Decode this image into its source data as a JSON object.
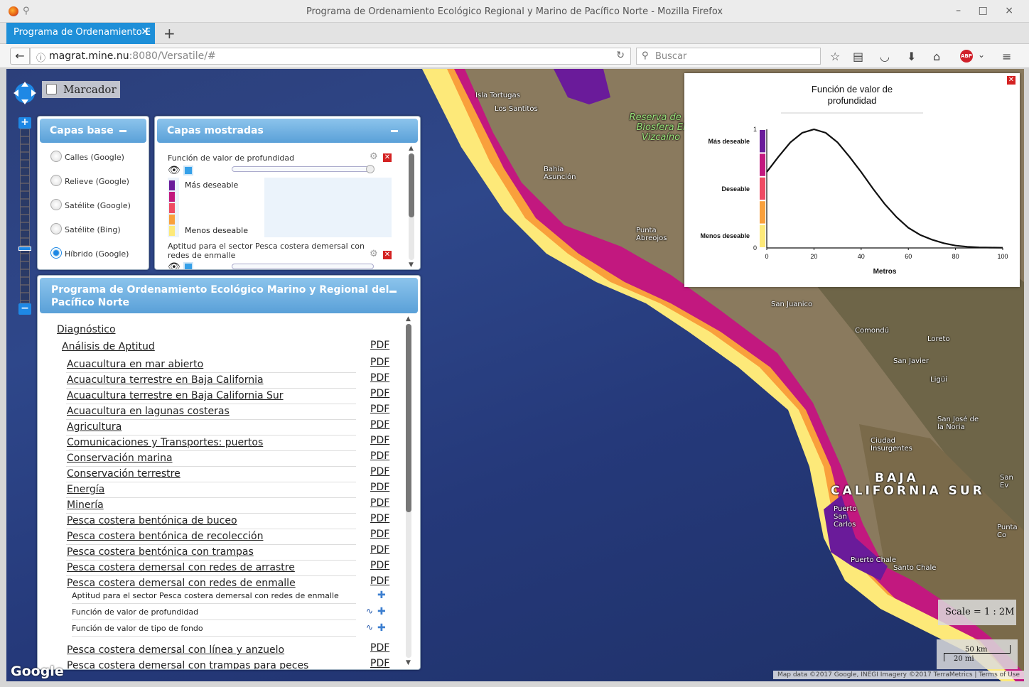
{
  "window": {
    "title": "Programa de Ordenamiento Ecológico Regional y Marino de Pacífico Norte - Mozilla Firefox",
    "controls": "– □ ×"
  },
  "tabs": [
    {
      "label": "Programa de Ordenamiento E",
      "active": true
    }
  ],
  "navbar": {
    "url_host": "magrat.mine.nu",
    "url_rest": ":8080/Versatile/#",
    "search_placeholder": "Buscar"
  },
  "map": {
    "marcador_label": "Marcador",
    "places": [
      {
        "id": "isla-tortugas",
        "name": "Isla Tortugas"
      },
      {
        "id": "los-santitos",
        "name": "Los Santitos"
      },
      {
        "id": "reserva",
        "name": "Reserva de la Biosfera El Vizcaíno"
      },
      {
        "id": "bahia-asuncion",
        "name": "Bahía Asunción"
      },
      {
        "id": "punta-abreojos",
        "name": "Punta Abreojos"
      },
      {
        "id": "san-juanico",
        "name": "San Juanico"
      },
      {
        "id": "comondu",
        "name": "Comondú"
      },
      {
        "id": "loreto",
        "name": "Loreto"
      },
      {
        "id": "san-javier",
        "name": "San Javier"
      },
      {
        "id": "ligui",
        "name": "Ligüí"
      },
      {
        "id": "san-jose-norte",
        "name": "San José de la Noria"
      },
      {
        "id": "ciudad-insurgentes",
        "name": "Ciudad Insurgentes"
      },
      {
        "id": "baja",
        "name": "BAJA"
      },
      {
        "id": "california-sur",
        "name": "CALIFORNIA SUR"
      },
      {
        "id": "puerto-san-carlos",
        "name": "Puerto San Carlos"
      },
      {
        "id": "puerto-chale",
        "name": "Puerto Chale"
      },
      {
        "id": "santo-chale",
        "name": "Santo Chale"
      },
      {
        "id": "punta-co",
        "name": "Punta Co"
      },
      {
        "id": "san-ev",
        "name": "San Ev"
      }
    ],
    "scale_text": "Scale = 1 : 2M",
    "scale_km": "50 km",
    "scale_mi": "20 mi",
    "google": "Google",
    "attribution": "Map data ©2017 Google, INEGI Imagery ©2017 TerraMetrics | Terms of Use"
  },
  "capas_base": {
    "title": "Capas base",
    "options": [
      {
        "label": "Calles (Google)",
        "selected": false
      },
      {
        "label": "Relieve (Google)",
        "selected": false
      },
      {
        "label": "Satélite (Google)",
        "selected": false
      },
      {
        "label": "Satélite (Bing)",
        "selected": false
      },
      {
        "label": "Híbrido (Google)",
        "selected": true
      }
    ]
  },
  "capas_mostradas": {
    "title": "Capas mostradas",
    "layers": [
      {
        "title": "Función de valor de profundidad"
      },
      {
        "title": "Aptitud para el sector Pesca costera demersal con redes de enmalle"
      }
    ],
    "legend": {
      "top_label": "Más deseable",
      "bottom_label": "Menos deseable",
      "colors": [
        "#6a1b9a",
        "#c2187f",
        "#ef4b64",
        "#f9a03c",
        "#fde979"
      ]
    }
  },
  "programa": {
    "title": "Programa de Ordenamiento Ecológico Marino y Regional del Pacífico Norte",
    "diagnostico": "Diagnóstico",
    "analisis": "Análisis de Aptitud",
    "pdf_label": "PDF",
    "items": [
      "Acuacultura en mar abierto",
      "Acuacultura terrestre en Baja California",
      "Acuacultura terrestre en Baja California Sur",
      "Acuacultura en lagunas costeras",
      "Agricultura",
      "Comunicaciones y Transportes: puertos",
      "Conservación marina",
      "Conservación terrestre",
      "Energía",
      "Minería",
      "Pesca costera bentónica de buceo",
      "Pesca costera bentónica de recolección",
      "Pesca costera bentónica con trampas",
      "Pesca costera demersal con redes de arrastre",
      "Pesca costera demersal con redes de enmalle"
    ],
    "sub_items": [
      "Aptitud para el sector Pesca costera demersal con redes de enmalle",
      "Función de valor de profundidad",
      "Función de valor de tipo de fondo"
    ],
    "after_items": [
      "Pesca costera demersal con línea y anzuelo",
      "Pesca costera demersal con trampas para peces"
    ]
  },
  "popup": {
    "title_line1": "Función de valor de",
    "title_line2": "profundidad",
    "xlabel": "Metros",
    "ylabel_high": "Más deseable",
    "ylabel_mid": "Deseable",
    "ylabel_low": "Menos deseable"
  },
  "chart_data": {
    "type": "line",
    "title": "Función de valor de profundidad",
    "xlabel": "Metros",
    "ylabel": "",
    "xlim": [
      0,
      100
    ],
    "ylim": [
      0,
      1
    ],
    "xticks": [
      0,
      20,
      40,
      60,
      80,
      100
    ],
    "yticks": [
      0,
      1
    ],
    "x": [
      0,
      5,
      10,
      15,
      20,
      25,
      30,
      35,
      40,
      45,
      50,
      55,
      60,
      65,
      70,
      75,
      80,
      85,
      90,
      95,
      100
    ],
    "series": [
      {
        "values": [
          0.64,
          0.77,
          0.89,
          0.97,
          1.0,
          0.97,
          0.89,
          0.77,
          0.64,
          0.5,
          0.37,
          0.26,
          0.17,
          0.11,
          0.07,
          0.04,
          0.02,
          0.01,
          0.005,
          0.003,
          0.002
        ]
      }
    ],
    "color_bands": [
      "#6a1b9a",
      "#c2187f",
      "#ef4b64",
      "#f9a03c",
      "#fde979"
    ]
  }
}
